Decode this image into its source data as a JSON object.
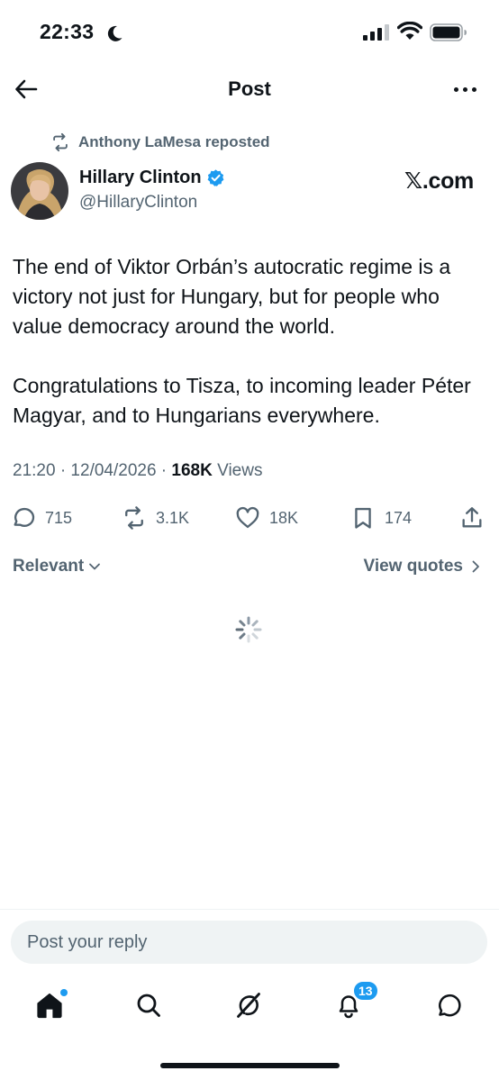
{
  "status_bar": {
    "time": "22:33",
    "icons": [
      "moon-icon",
      "cellular-signal-icon",
      "wifi-icon",
      "battery-icon"
    ]
  },
  "header": {
    "title": "Post",
    "back_icon": "arrow-left-icon",
    "more_icon": "more-horizontal-icon"
  },
  "post": {
    "repost_by": "Anthony LaMesa reposted",
    "author_name": "Hillary Clinton",
    "author_handle": "@HillaryClinton",
    "verified": true,
    "source_label": "𝕏.com",
    "paragraphs": [
      "The end of Viktor Orbán’s autocratic regime is a victory not just for Hungary, but for people who value democracy around the world.",
      "Congratulations to Tisza, to incoming leader Péter Magyar, and to Hungarians everywhere."
    ],
    "timestamp": "21:20 · 12/04/2026 · ",
    "views_count": "168K",
    "views_label": " Views",
    "stats": {
      "replies": "715",
      "reposts": "3.1K",
      "likes": "18K",
      "bookmarks": "174"
    }
  },
  "filters": {
    "sort_label": "Relevant",
    "view_quotes_label": "View quotes"
  },
  "reply": {
    "placeholder": "Post your reply"
  },
  "tab_bar": {
    "items": [
      "home-icon",
      "search-icon",
      "grok-icon",
      "notifications-icon",
      "messages-icon"
    ],
    "notifications_badge": "13"
  },
  "colors": {
    "text_primary": "#0f1419",
    "text_secondary": "#536471",
    "accent": "#1d9bf0",
    "input_background": "#eff3f4"
  }
}
